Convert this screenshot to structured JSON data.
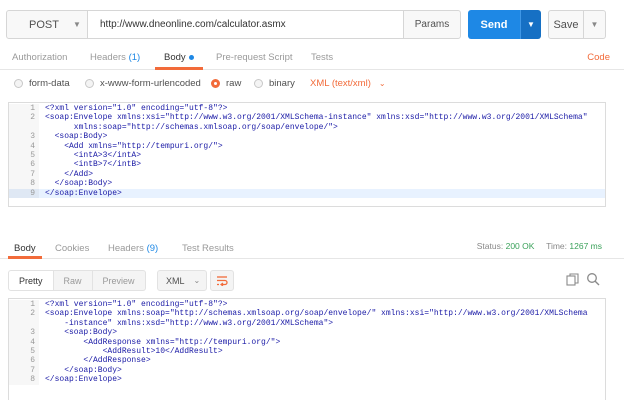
{
  "request": {
    "method": "POST",
    "url": "http://www.dneonline.com/calculator.asmx",
    "params_label": "Params",
    "send_label": "Send",
    "save_label": "Save"
  },
  "request_tabs": {
    "authorization": "Authorization",
    "headers": "Headers",
    "headers_count": "(1)",
    "body": "Body",
    "prerequest": "Pre-request Script",
    "tests": "Tests",
    "code": "Code"
  },
  "body_types": {
    "form_data": "form-data",
    "urlencoded": "x-www-form-urlencoded",
    "raw": "raw",
    "binary": "binary",
    "selected": "raw",
    "content_type": "XML (text/xml)"
  },
  "request_body": [
    {
      "n": "1",
      "text": "<?xml version=\"1.0\" encoding=\"utf-8\"?>"
    },
    {
      "n": "2",
      "text": "<soap:Envelope xmlns:xsi=\"http://www.w3.org/2001/XMLSchema-instance\" xmlns:xsd=\"http://www.w3.org/2001/XMLSchema\""
    },
    {
      "n": "",
      "text": "      xmlns:soap=\"http://schemas.xmlsoap.org/soap/envelope/\">"
    },
    {
      "n": "3",
      "text": "  <soap:Body>"
    },
    {
      "n": "4",
      "text": "    <Add xmlns=\"http://tempuri.org/\">"
    },
    {
      "n": "5",
      "text": "      <intA>3</intA>"
    },
    {
      "n": "6",
      "text": "      <intB>7</intB>"
    },
    {
      "n": "7",
      "text": "    </Add>"
    },
    {
      "n": "8",
      "text": "  </soap:Body>"
    },
    {
      "n": "9",
      "text": "</soap:Envelope>"
    }
  ],
  "response_tabs": {
    "body": "Body",
    "cookies": "Cookies",
    "headers": "Headers",
    "headers_count": "(9)",
    "test_results": "Test Results",
    "status_label": "Status:",
    "status_value": "200 OK",
    "time_label": "Time:",
    "time_value": "1267 ms"
  },
  "response_toolbar": {
    "pretty": "Pretty",
    "raw": "Raw",
    "preview": "Preview",
    "format": "XML"
  },
  "response_body": [
    {
      "n": "1",
      "text": "<?xml version=\"1.0\" encoding=\"utf-8\"?>"
    },
    {
      "n": "2",
      "text": "<soap:Envelope xmlns:soap=\"http://schemas.xmlsoap.org/soap/envelope/\" xmlns:xsi=\"http://www.w3.org/2001/XMLSchema"
    },
    {
      "n": "",
      "text": "    -instance\" xmlns:xsd=\"http://www.w3.org/2001/XMLSchema\">"
    },
    {
      "n": "3",
      "text": "    <soap:Body>"
    },
    {
      "n": "4",
      "text": "        <AddResponse xmlns=\"http://tempuri.org/\">"
    },
    {
      "n": "5",
      "text": "            <AddResult>10</AddResult>"
    },
    {
      "n": "6",
      "text": "        </AddResponse>"
    },
    {
      "n": "7",
      "text": "    </soap:Body>"
    },
    {
      "n": "8",
      "text": "</soap:Envelope>"
    }
  ],
  "colors": {
    "accent": "#f26b3a",
    "send": "#1e88e5",
    "status_ok": "#3aa15a",
    "xml_text": "#1a1aa6"
  }
}
